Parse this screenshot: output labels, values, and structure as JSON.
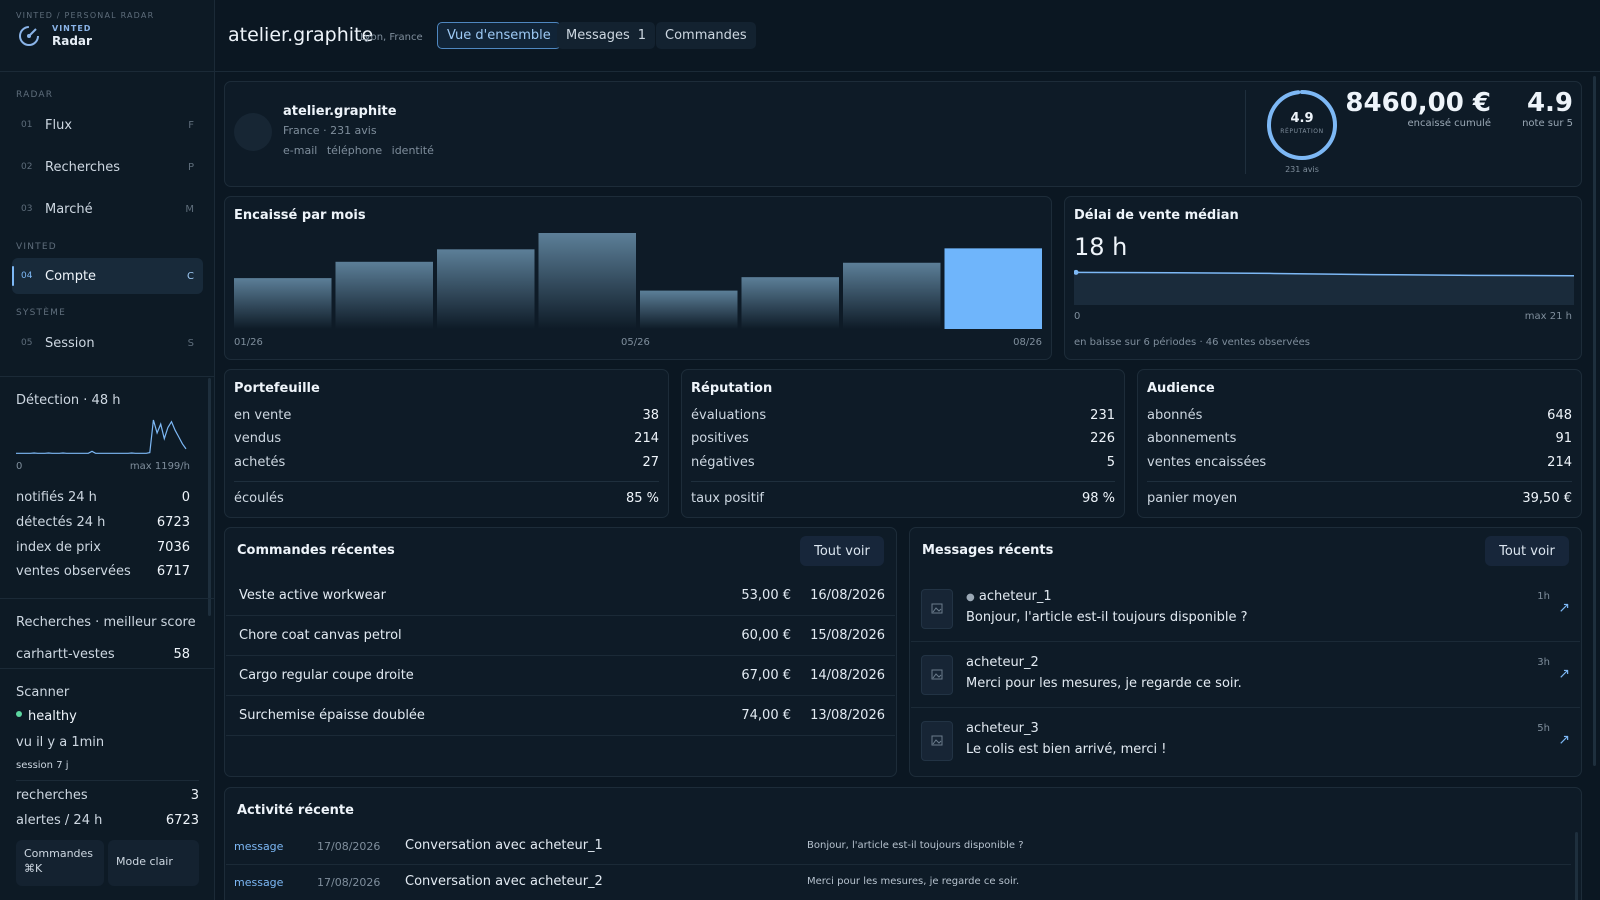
{
  "brand": {
    "crumb": "VINTED / PERSONAL RADAR",
    "small": "VINTED",
    "name": "Radar"
  },
  "nav": {
    "section_radar": "RADAR",
    "section_vinted": "VINTED",
    "section_system": "SYSTÈME",
    "items": [
      {
        "num": "01",
        "label": "Flux",
        "key": "F"
      },
      {
        "num": "02",
        "label": "Recherches",
        "key": "P"
      },
      {
        "num": "03",
        "label": "Marché",
        "key": "M"
      },
      {
        "num": "04",
        "label": "Compte",
        "key": "C"
      },
      {
        "num": "05",
        "label": "Session",
        "key": "S"
      }
    ]
  },
  "detection": {
    "title": "Détection · 48 h",
    "axis_min": "0",
    "axis_max": "max 1199/h",
    "series": [
      0.02,
      0.02,
      0.02,
      0.02,
      0.02,
      0.03,
      0.02,
      0.02,
      0.02,
      0.03,
      0.02,
      0.02,
      0.02,
      0.03,
      0.02,
      0.02,
      0.02,
      0.02,
      0.02,
      0.02,
      0.02,
      0.08,
      0.02,
      0.02,
      0.02,
      0.02,
      0.02,
      0.02,
      0.02,
      0.02,
      0.02,
      0.02,
      0.03,
      0.02,
      0.02,
      0.02,
      0.02,
      0.04,
      1.0,
      0.62,
      0.88,
      0.45,
      0.78,
      0.95,
      0.7,
      0.5,
      0.3,
      0.15
    ],
    "stats": [
      {
        "label": "notifiés 24 h",
        "value": "0"
      },
      {
        "label": "détectés 24 h",
        "value": "6723"
      },
      {
        "label": "index de prix",
        "value": "7036"
      },
      {
        "label": "ventes observées",
        "value": "6717"
      }
    ]
  },
  "searches": {
    "title": "Recherches · meilleur score",
    "top_label": "carhartt-vestes",
    "top_value": "58"
  },
  "scanner": {
    "title": "Scanner",
    "status": "healthy",
    "seen": "vu il y a 1min",
    "session": "session 7 j",
    "stats": [
      {
        "label": "recherches",
        "value": "3"
      },
      {
        "label": "alertes / 24 h",
        "value": "6723"
      }
    ],
    "cmd_label": "Commandes",
    "cmd_shortcut": "⌘K",
    "theme_label": "Mode clair"
  },
  "header": {
    "title": "atelier.graphite",
    "location": "Lyon, France",
    "tabs": [
      {
        "label": "Vue d'ensemble",
        "badge": ""
      },
      {
        "label": "Messages",
        "badge": "1"
      },
      {
        "label": "Commandes",
        "badge": ""
      }
    ]
  },
  "profile": {
    "name": "atelier.graphite",
    "meta": "France · 231 avis",
    "verifications": [
      "e-mail",
      "téléphone",
      "identité"
    ],
    "rating": "4.9",
    "rating_label": "RÉPUTATION",
    "rating_sub": "231 avis",
    "rating_fraction": 0.98,
    "revenue": "8460,00 €",
    "revenue_label": "encaissé cumulé",
    "score": "4.9",
    "score_label": "note sur 5"
  },
  "monthly": {
    "title": "Encaissé par mois",
    "x_labels": [
      "01/26",
      "05/26",
      "08/26"
    ],
    "bars": [
      0.53,
      0.7,
      0.83,
      1.0,
      0.4,
      0.54,
      0.69,
      0.84
    ],
    "highlight_index": 7
  },
  "delay": {
    "title": "Délai de vente médian",
    "value": "18 h",
    "series": [
      0.86,
      0.85,
      0.83,
      0.8,
      0.78,
      0.77
    ],
    "axis_min": "0",
    "axis_max": "max 21 h",
    "note": "en baisse sur 6 périodes · 46 ventes observées"
  },
  "portfolio": {
    "title": "Portefeuille",
    "rows": [
      {
        "label": "en vente",
        "value": "38"
      },
      {
        "label": "vendus",
        "value": "214"
      },
      {
        "label": "achetés",
        "value": "27"
      }
    ],
    "footer": {
      "label": "écoulés",
      "value": "85 %"
    }
  },
  "reputation": {
    "title": "Réputation",
    "rows": [
      {
        "label": "évaluations",
        "value": "231"
      },
      {
        "label": "positives",
        "value": "226"
      },
      {
        "label": "négatives",
        "value": "5"
      }
    ],
    "footer": {
      "label": "taux positif",
      "value": "98 %"
    }
  },
  "audience": {
    "title": "Audience",
    "rows": [
      {
        "label": "abonnés",
        "value": "648"
      },
      {
        "label": "abonnements",
        "value": "91"
      },
      {
        "label": "ventes encaissées",
        "value": "214"
      }
    ],
    "footer": {
      "label": "panier moyen",
      "value": "39,50 €"
    }
  },
  "orders": {
    "title": "Commandes récentes",
    "see_all": "Tout voir",
    "rows": [
      {
        "name": "Veste active workwear",
        "price": "53,00 €",
        "date": "16/08/2026"
      },
      {
        "name": "Chore coat canvas petrol",
        "price": "60,00 €",
        "date": "15/08/2026"
      },
      {
        "name": "Cargo regular coupe droite",
        "price": "67,00 €",
        "date": "14/08/2026"
      },
      {
        "name": "Surchemise épaisse doublée",
        "price": "74,00 €",
        "date": "13/08/2026"
      }
    ]
  },
  "messages": {
    "title": "Messages récents",
    "see_all": "Tout voir",
    "rows": [
      {
        "who": "acheteur_1",
        "text": "Bonjour, l'article est-il toujours disponible ?",
        "time": "1h",
        "unread": true
      },
      {
        "who": "acheteur_2",
        "text": "Merci pour les mesures, je regarde ce soir.",
        "time": "3h",
        "unread": false
      },
      {
        "who": "acheteur_3",
        "text": "Le colis est bien arrivé, merci !",
        "time": "5h",
        "unread": false
      }
    ]
  },
  "activity": {
    "title": "Activité récente",
    "rows": [
      {
        "type": "message",
        "date": "17/08/2026",
        "title": "Conversation avec acheteur_1",
        "text": "Bonjour, l'article est-il toujours disponible ?"
      },
      {
        "type": "message",
        "date": "17/08/2026",
        "title": "Conversation avec acheteur_2",
        "text": "Merci pour les mesures, je regarde ce soir."
      }
    ]
  },
  "colors": {
    "accent": "#7db8f5",
    "bar": "#5c7f98",
    "bar_highlight": "#6fb5fb",
    "healthy": "#5cd6a0"
  }
}
